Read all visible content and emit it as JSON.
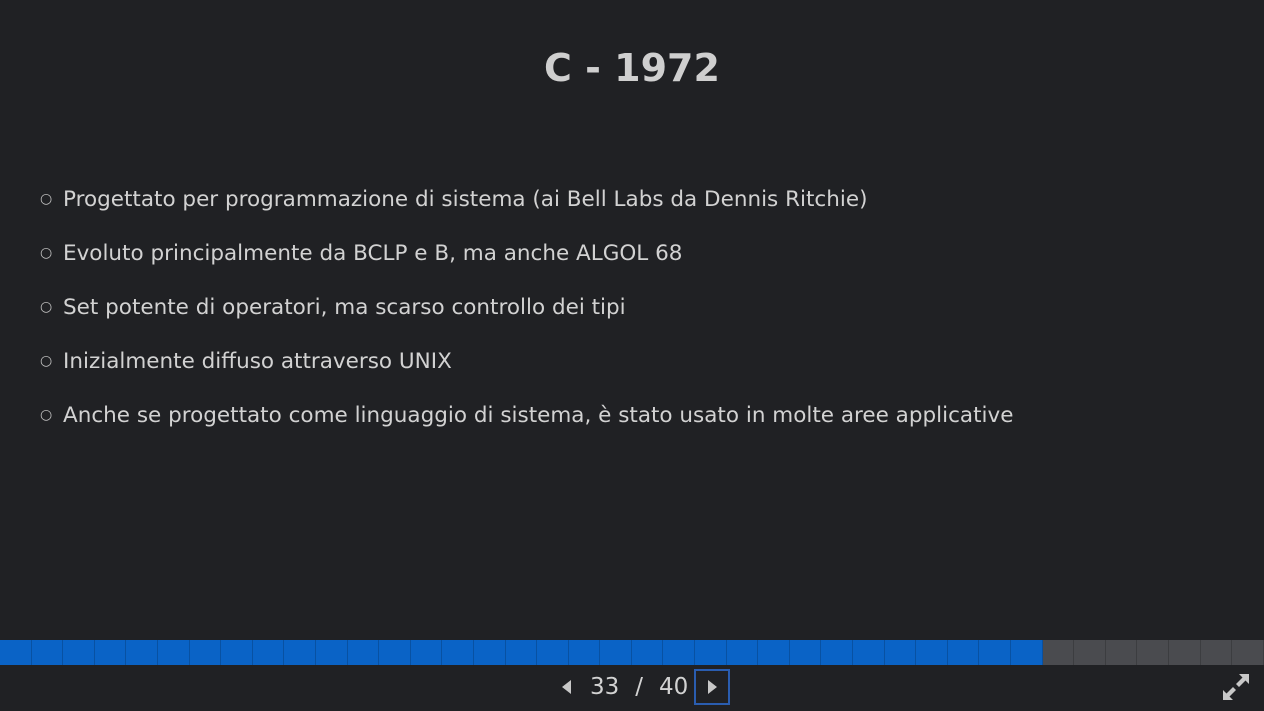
{
  "slide": {
    "title": "C - 1972",
    "bullet_marker": "○",
    "bullets": [
      "Progettato per programmazione di sistema (ai Bell Labs da Dennis Ritchie)",
      "Evoluto principalmente da BCLP e B, ma anche ALGOL 68",
      "Set potente di operatori, ma scarso controllo dei tipi",
      "Inizialmente diffuso attraverso UNIX",
      "Anche se progettato come linguaggio di sistema, è stato usato in molte aree applicative"
    ]
  },
  "navigation": {
    "current_page": "33",
    "separator": "/",
    "total_pages": "40",
    "prev_icon": "caret-left-icon",
    "next_icon": "caret-right-icon",
    "fullscreen_icon": "expand-icon"
  },
  "progress": {
    "completed": 33,
    "total": 40
  },
  "colors": {
    "background": "#202124",
    "progress_done": "#0a63c6",
    "progress_todo": "#4a4b4f",
    "focus_outline": "#2a5db0"
  }
}
